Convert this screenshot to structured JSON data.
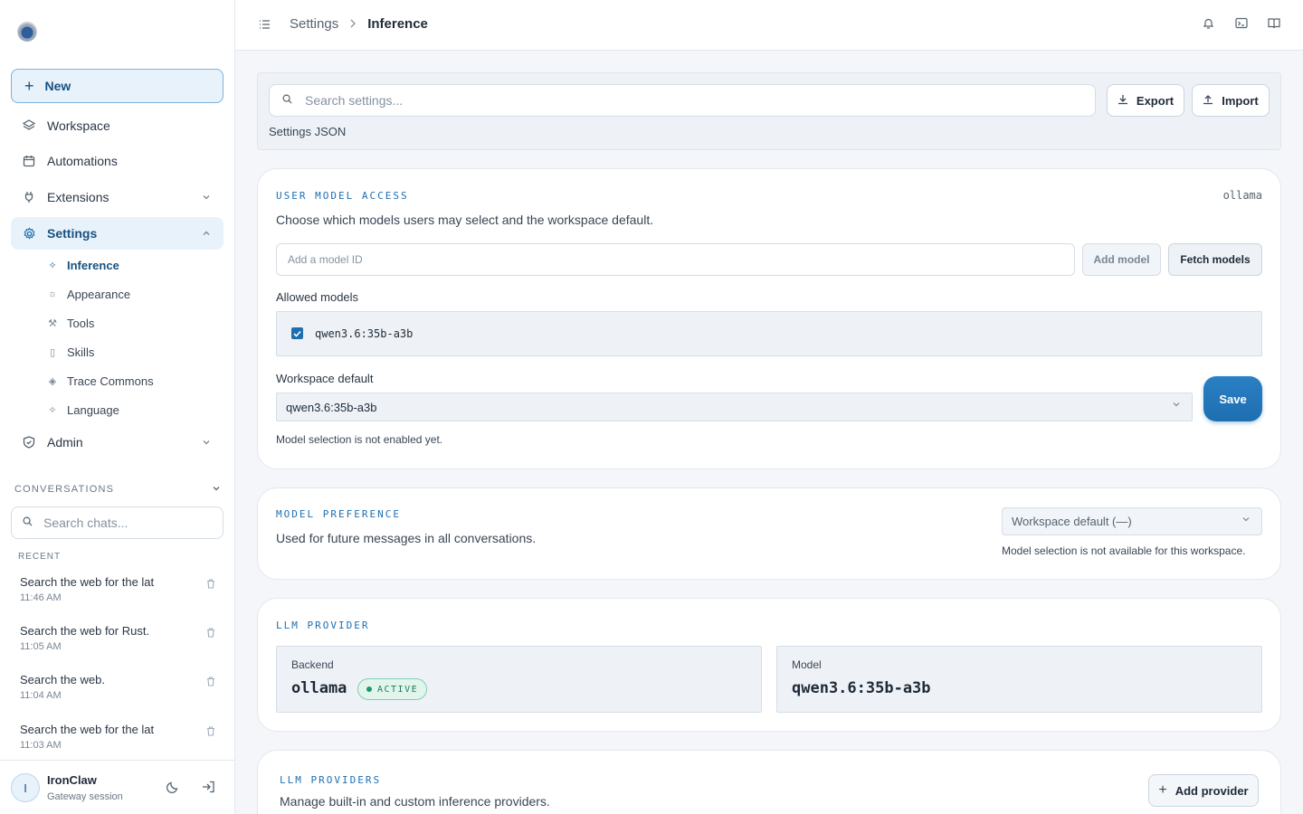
{
  "sidebar": {
    "new_label": "New",
    "nav": [
      {
        "label": "Workspace",
        "icon": "layers-icon"
      },
      {
        "label": "Automations",
        "icon": "calendar-icon"
      },
      {
        "label": "Extensions",
        "icon": "plug-icon"
      },
      {
        "label": "Settings",
        "icon": "gear-icon"
      },
      {
        "label": "Admin",
        "icon": "shield-icon"
      }
    ],
    "settings_sub": [
      {
        "label": "Inference",
        "icon": "sparkle-icon"
      },
      {
        "label": "Appearance",
        "icon": "sun-icon"
      },
      {
        "label": "Tools",
        "icon": "wrench-icon"
      },
      {
        "label": "Skills",
        "icon": "file-icon"
      },
      {
        "label": "Trace Commons",
        "icon": "layers-icon"
      },
      {
        "label": "Language",
        "icon": "sparkle-icon"
      }
    ],
    "conversations_label": "CONVERSATIONS",
    "search_placeholder": "Search chats...",
    "recent_label": "RECENT",
    "chats": [
      {
        "title": "Search the web for the lat",
        "time": "11:46 AM"
      },
      {
        "title": "Search the web for Rust.",
        "time": "11:05 AM"
      },
      {
        "title": "Search the web.",
        "time": "11:04 AM"
      },
      {
        "title": "Search the web for the lat",
        "time": "11:03 AM"
      }
    ],
    "user": {
      "initial": "I",
      "name": "IronClaw",
      "subtitle": "Gateway session"
    }
  },
  "header": {
    "breadcrumb": [
      "Settings",
      "Inference"
    ]
  },
  "toolbar": {
    "search_placeholder": "Search settings...",
    "export_label": "Export",
    "import_label": "Import",
    "json_label": "Settings JSON"
  },
  "user_model_access": {
    "title": "USER MODEL ACCESS",
    "backend_tag": "ollama",
    "description": "Choose which models users may select and the workspace default.",
    "model_input_placeholder": "Add a model ID",
    "add_model_label": "Add model",
    "fetch_models_label": "Fetch models",
    "allowed_label": "Allowed models",
    "allowed_models": [
      {
        "name": "qwen3.6:35b-a3b",
        "checked": true
      }
    ],
    "default_label": "Workspace default",
    "default_value": "qwen3.6:35b-a3b",
    "save_label": "Save",
    "note": "Model selection is not enabled yet."
  },
  "model_preference": {
    "title": "MODEL PREFERENCE",
    "description": "Used for future messages in all conversations.",
    "select_value": "Workspace default (—)",
    "note": "Model selection is not available for this workspace."
  },
  "llm_provider": {
    "title": "LLM PROVIDER",
    "backend_label": "Backend",
    "backend_value": "ollama",
    "status": "ACTIVE",
    "model_label": "Model",
    "model_value": "qwen3.6:35b-a3b"
  },
  "llm_providers": {
    "title": "LLM PROVIDERS",
    "description": "Manage built-in and custom inference providers.",
    "add_label": "Add provider"
  },
  "colors": {
    "accent": "#1e6fb0",
    "active_badge": "#1d7a57"
  }
}
